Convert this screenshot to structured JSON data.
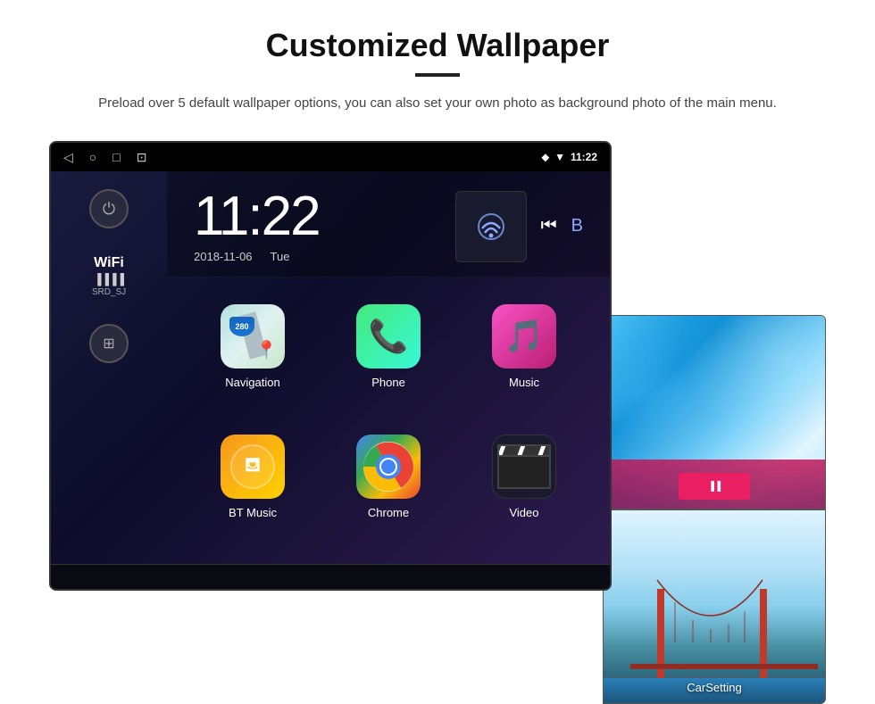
{
  "header": {
    "title": "Customized Wallpaper",
    "description": "Preload over 5 default wallpaper options, you can also set your own photo as background photo of the main menu."
  },
  "status_bar": {
    "time": "11:22",
    "wifi_icon": "▼",
    "location_icon": "⬥"
  },
  "clock": {
    "time": "11:22",
    "date": "2018-11-06",
    "day": "Tue"
  },
  "sidebar": {
    "wifi_label": "WiFi",
    "wifi_name": "SRD_SJ"
  },
  "apps": [
    {
      "id": "navigation",
      "label": "Navigation",
      "type": "navigation"
    },
    {
      "id": "phone",
      "label": "Phone",
      "type": "phone"
    },
    {
      "id": "music",
      "label": "Music",
      "type": "music"
    },
    {
      "id": "btmusic",
      "label": "BT Music",
      "type": "btmusic"
    },
    {
      "id": "chrome",
      "label": "Chrome",
      "type": "chrome"
    },
    {
      "id": "video",
      "label": "Video",
      "type": "video"
    }
  ],
  "wallpaper_labels": {
    "car_setting": "CarSetting"
  },
  "nav_shield_number": "280"
}
